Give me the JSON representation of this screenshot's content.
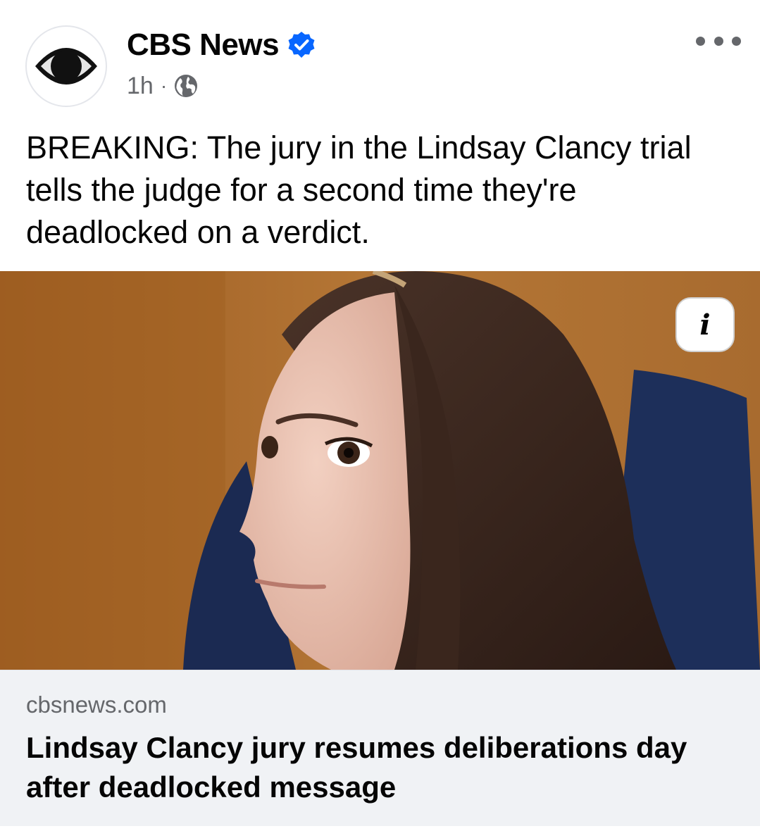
{
  "post": {
    "page_name": "CBS News",
    "verified_icon": "verified-badge-icon",
    "time": "1h",
    "separator": "·",
    "audience_icon": "globe-icon",
    "text": "BREAKING: The jury in the Lindsay Clancy trial tells the judge for a second time they're deadlocked on a verdict."
  },
  "link_preview": {
    "domain": "cbsnews.com",
    "title": "Lindsay Clancy jury resumes deliberations day after deadlocked message",
    "info_button_label": "i"
  },
  "colors": {
    "verified_blue": "#0866ff",
    "secondary_text": "#65676b",
    "card_background": "#f0f2f5"
  }
}
